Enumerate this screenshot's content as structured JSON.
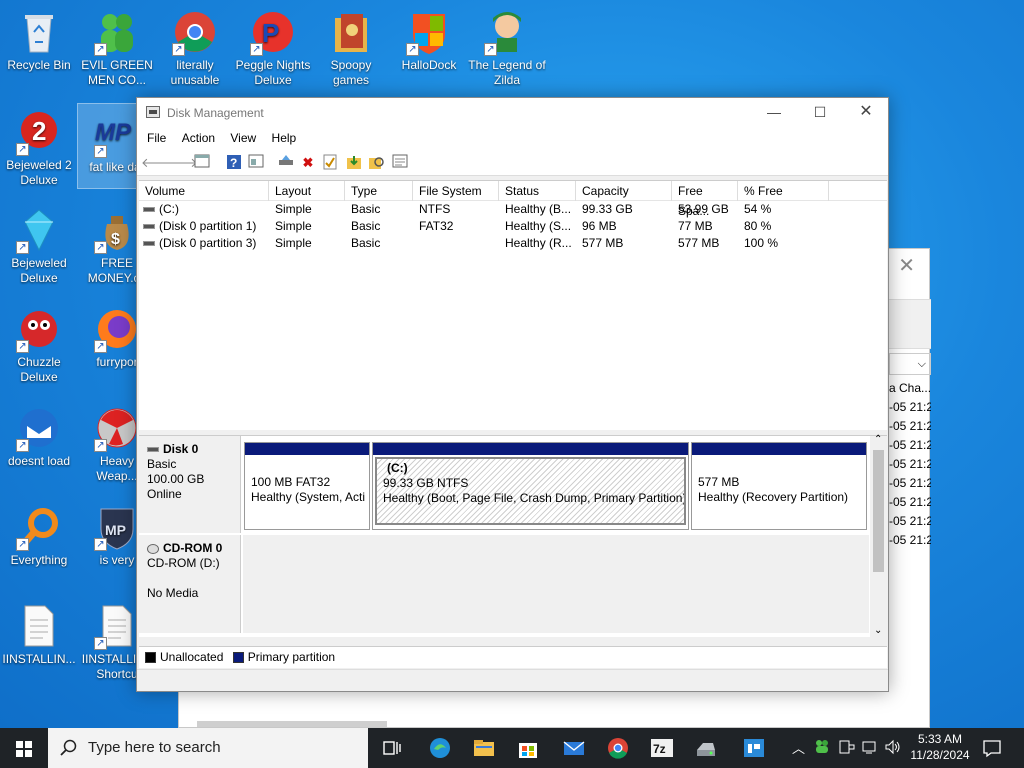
{
  "desktop_icons": [
    {
      "label": "Recycle Bin"
    },
    {
      "label": "EVIL GREEN MEN CO..."
    },
    {
      "label": "literally unusable"
    },
    {
      "label": "Peggle Nights Deluxe"
    },
    {
      "label": "Spoopy games"
    },
    {
      "label": "HalloDock"
    },
    {
      "label": "The Legend of Zilda"
    },
    {
      "label": "Bejeweled 2 Deluxe"
    },
    {
      "label": "fat like dar"
    },
    {
      "label": "Bejeweled Deluxe"
    },
    {
      "label": "FREE MONEY.co"
    },
    {
      "label": "Chuzzle Deluxe"
    },
    {
      "label": "furrypor"
    },
    {
      "label": "doesnt load"
    },
    {
      "label": "Heavy Weap..."
    },
    {
      "label": "Everything"
    },
    {
      "label": "is very"
    },
    {
      "label": "IINSTALLIN..."
    },
    {
      "label": "IINSTALLIN - Shortcu"
    }
  ],
  "back_window": {
    "header_fragment": "a Cha...",
    "rows": [
      "-05 21:2",
      "-05 21:2",
      "-05 21:2",
      "-05 21:2",
      "-05 21:2",
      "-05 21:2",
      "-05 21:2",
      "-05 21:2"
    ]
  },
  "window": {
    "title": "Disk Management",
    "menu": [
      "File",
      "Action",
      "View",
      "Help"
    ]
  },
  "volume_table": {
    "columns": [
      "Volume",
      "Layout",
      "Type",
      "File System",
      "Status",
      "Capacity",
      "Free Spa...",
      "% Free"
    ],
    "rows": [
      [
        "(C:)",
        "Simple",
        "Basic",
        "NTFS",
        "Healthy (B...",
        "99.33 GB",
        "53.99 GB",
        "54 %"
      ],
      [
        "(Disk 0 partition 1)",
        "Simple",
        "Basic",
        "FAT32",
        "Healthy (S...",
        "96 MB",
        "77 MB",
        "80 %"
      ],
      [
        "(Disk 0 partition 3)",
        "Simple",
        "Basic",
        "",
        "Healthy (R...",
        "577 MB",
        "577 MB",
        "100 %"
      ]
    ]
  },
  "disks": {
    "disk0": {
      "name": "Disk 0",
      "type": "Basic",
      "size": "100.00 GB",
      "state": "Online"
    },
    "partitions": [
      {
        "line1": "100 MB FAT32",
        "line2": "Healthy (System, Acti"
      },
      {
        "title": "(C:)",
        "line1": "99.33 GB NTFS",
        "line2": "Healthy (Boot, Page File, Crash Dump, Primary Partition)"
      },
      {
        "line1": "577 MB",
        "line2": "Healthy (Recovery Partition)"
      }
    ],
    "cdrom": {
      "name": "CD-ROM 0",
      "drive": "CD-ROM (D:)",
      "media": "No Media"
    }
  },
  "legend": {
    "items": [
      {
        "label": "Unallocated",
        "color": "#000000"
      },
      {
        "label": "Primary partition",
        "color": "#0a1a7a"
      }
    ]
  },
  "taskbar": {
    "search_placeholder": "Type here to search",
    "time": "5:33 AM",
    "date": "11/28/2024",
    "pinned": [
      "task-view-icon",
      "edge-icon",
      "file-explorer-icon",
      "store-icon",
      "mail-icon",
      "chrome-icon",
      "7zip-icon",
      "drive-icon",
      "app-icon"
    ]
  }
}
